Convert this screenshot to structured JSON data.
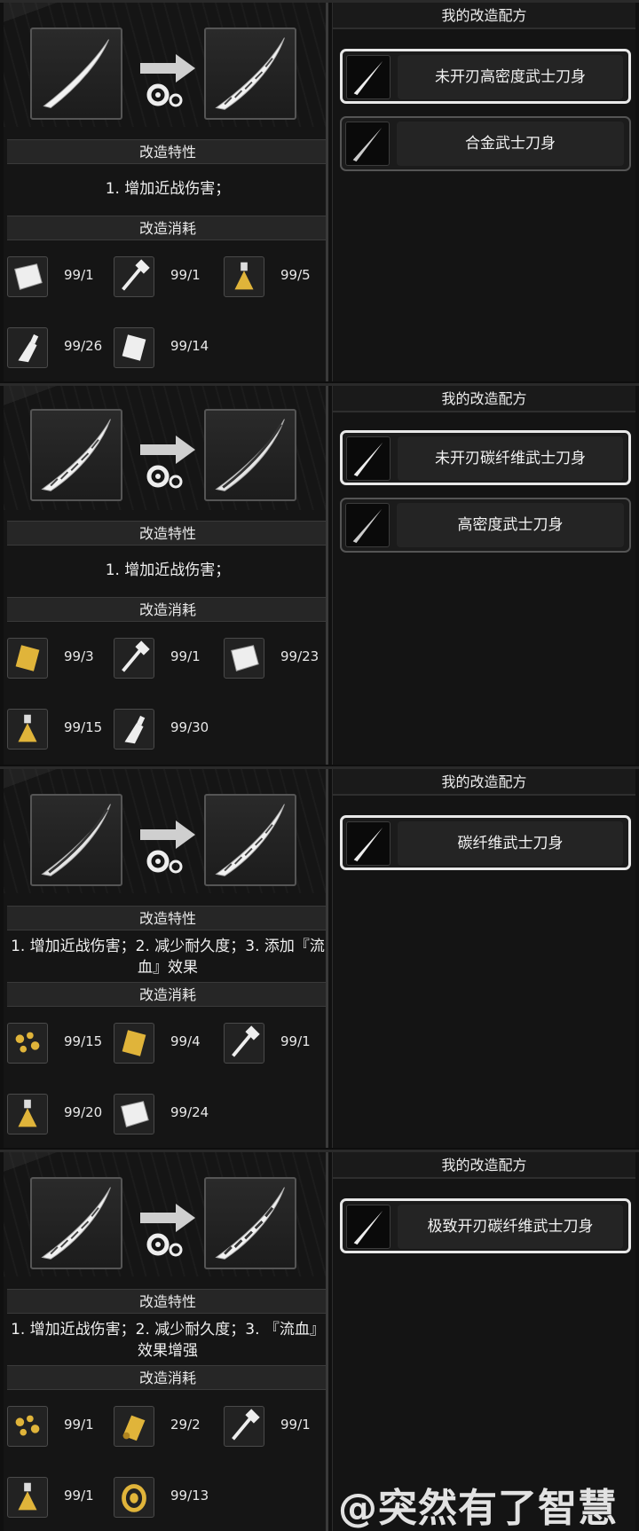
{
  "panels": [
    {
      "section_feature_label": "改造特性",
      "section_cost_label": "改造消耗",
      "feature_text": "1. 增加近战伤害；",
      "recipes_header": "我的改造配方",
      "materials": [
        {
          "icon": "cloth-icon",
          "count": "99/1"
        },
        {
          "icon": "tool-icon",
          "count": "99/1"
        },
        {
          "icon": "potion-icon",
          "count": "99/5"
        },
        {
          "icon": "oil-bottle-icon",
          "count": "99/26"
        },
        {
          "icon": "metal-plate-icon",
          "count": "99/14"
        }
      ],
      "recipes": [
        {
          "label": "未开刃高密度武士刀身",
          "selected": true
        },
        {
          "label": "合金武士刀身",
          "selected": false
        }
      ]
    },
    {
      "section_feature_label": "改造特性",
      "section_cost_label": "改造消耗",
      "feature_text": "1. 增加近战伤害；",
      "recipes_header": "我的改造配方",
      "materials": [
        {
          "icon": "gold-plate-icon",
          "count": "99/3"
        },
        {
          "icon": "tool-icon",
          "count": "99/1"
        },
        {
          "icon": "cloth-icon",
          "count": "99/23"
        },
        {
          "icon": "potion-icon",
          "count": "99/15"
        },
        {
          "icon": "oil-bottle-icon",
          "count": "99/30"
        }
      ],
      "recipes": [
        {
          "label": "未开刃碳纤维武士刀身",
          "selected": true
        },
        {
          "label": "高密度武士刀身",
          "selected": false
        }
      ]
    },
    {
      "section_feature_label": "改造特性",
      "section_cost_label": "改造消耗",
      "feature_text": "1. 增加近战伤害；2. 减少耐久度；3. 添加『流血』效果",
      "recipes_header": "我的改造配方",
      "materials": [
        {
          "icon": "gold-nuggets-icon",
          "count": "99/15"
        },
        {
          "icon": "gold-plate-icon",
          "count": "99/4"
        },
        {
          "icon": "tool-icon",
          "count": "99/1"
        },
        {
          "icon": "potion-icon",
          "count": "99/20"
        },
        {
          "icon": "cloth-icon",
          "count": "99/24"
        }
      ],
      "recipes": [
        {
          "label": "碳纤维武士刀身",
          "selected": true
        }
      ]
    },
    {
      "section_feature_label": "改造特性",
      "section_cost_label": "改造消耗",
      "feature_text": "1. 增加近战伤害；2. 减少耐久度；3. 『流血』效果增强",
      "recipes_header": "我的改造配方",
      "materials": [
        {
          "icon": "gold-nuggets-icon",
          "count": "99/1"
        },
        {
          "icon": "gold-scroll-icon",
          "count": "29/2"
        },
        {
          "icon": "tool-icon",
          "count": "99/1"
        },
        {
          "icon": "potion-icon",
          "count": "99/1"
        },
        {
          "icon": "gold-coil-icon",
          "count": "99/13"
        }
      ],
      "recipes": [
        {
          "label": "极致开刃碳纤维武士刀身",
          "selected": true
        }
      ]
    }
  ],
  "watermark": "@突然有了智慧",
  "colors": {
    "background": "#0e0e0e",
    "panel": "#151515",
    "gold": "#e0b43a",
    "text": "#e6e6e6"
  }
}
